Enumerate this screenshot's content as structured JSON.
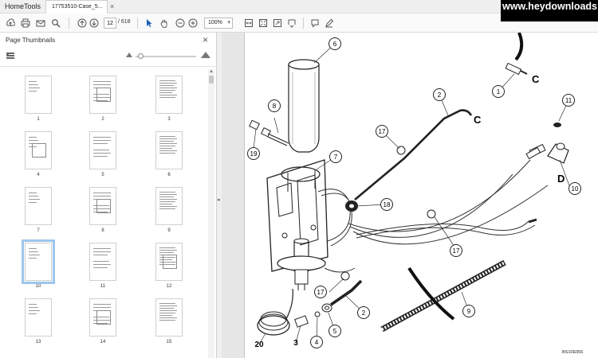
{
  "menu": {
    "home": "Home",
    "tools": "Tools"
  },
  "tab": {
    "title": "17753510-Case_5...",
    "close": "×"
  },
  "watermark": "www.heydownloads",
  "toolbar": {
    "page_current": "12",
    "page_total": "/ 618",
    "zoom": "100%",
    "icons": [
      "upload-icon",
      "print-icon",
      "email-icon",
      "search-icon",
      "page-up-icon",
      "page-down-icon",
      "select-cursor-icon",
      "hand-icon",
      "zoom-out-icon",
      "zoom-in-icon",
      "zoom-dropdown-icon",
      "fit-width-icon",
      "fit-page-icon",
      "scroll-mode-icon",
      "comment-icon",
      "pen-icon"
    ]
  },
  "panel": {
    "title": "Page Thumbnails",
    "close": "×",
    "selected_page": "10",
    "thumbnails": [
      "1",
      "2",
      "3",
      "4",
      "5",
      "6",
      "7",
      "8",
      "9",
      "10",
      "11",
      "12",
      "13",
      "14",
      "15"
    ]
  },
  "diagram": {
    "callouts": [
      "1",
      "2",
      "2",
      "3",
      "4",
      "5",
      "6",
      "7",
      "8",
      "9",
      "10",
      "11",
      "17",
      "17",
      "17",
      "18",
      "19",
      "20"
    ],
    "connector_letters": [
      "C",
      "C",
      "D"
    ],
    "figure_code": "BS10E056"
  }
}
